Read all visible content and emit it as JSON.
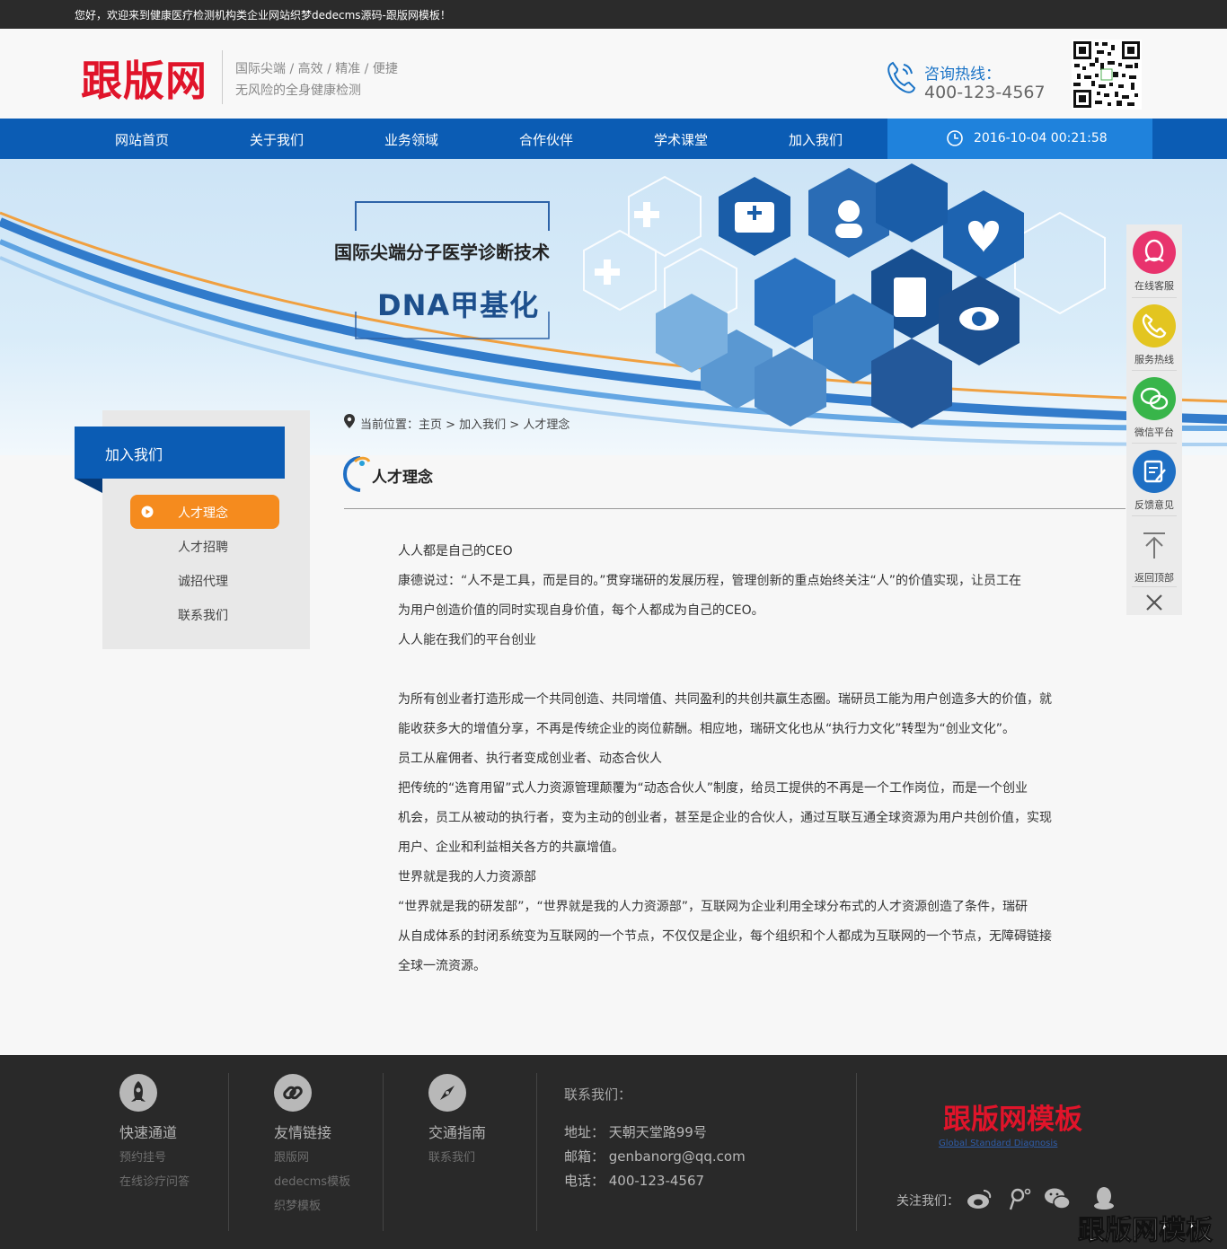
{
  "topbar": {
    "welcome": "您好，欢迎来到健康医疗检测机构类企业网站织梦dedecms源码-跟版网模板！"
  },
  "header": {
    "logo": "跟版网",
    "tagline1": "国际尖端 / 高效 / 精准 / 便捷",
    "tagline2": "无风险的全身健康检测",
    "hotline_label": "咨询热线：",
    "hotline_number": "400-123-4567"
  },
  "nav": {
    "items": [
      {
        "label": "网站首页"
      },
      {
        "label": "关于我们"
      },
      {
        "label": "业务领域"
      },
      {
        "label": "合作伙伴"
      },
      {
        "label": "学术课堂"
      },
      {
        "label": "加入我们"
      }
    ],
    "datetime": "2016-10-04 00:21:58"
  },
  "banner": {
    "title": "国际尖端分子医学诊断技术",
    "subtitle": "DNA甲基化"
  },
  "sidebar": {
    "heading": "加入我们",
    "items": [
      {
        "label": "人才理念"
      },
      {
        "label": "人才招聘"
      },
      {
        "label": "诚招代理"
      },
      {
        "label": "联系我们"
      }
    ]
  },
  "breadcrumb": "当前位置：主页 > 加入我们 > 人才理念",
  "article": {
    "title": "人才理念",
    "lines": [
      " 人人都是自己的CEO",
      "康德说过：“人不是工具，而是目的。”贯穿瑞研的发展历程，管理创新的重点始终关注“人”的价值实现，让员工在",
      "为用户创造价值的同时实现自身价值，每个人都成为自己的CEO。",
      "人人能在我们的平台创业",
      "为所有创业者打造形成一个共同创造、共同增值、共同盈利的共创共赢生态圈。瑞研员工能为用户创造多大的价值，就",
      "能收获多大的增值分享，不再是传统企业的岗位薪酬。相应地，瑞研文化也从“执行力文化”转型为“创业文化”。",
      "员工从雇佣者、执行者变成创业者、动态合伙人",
      "把传统的“选育用留”式人力资源管理颠覆为“动态合伙人”制度，给员工提供的不再是一个工作岗位，而是一个创业",
      "机会，员工从被动的执行者，变为主动的创业者，甚至是企业的合伙人，通过互联互通全球资源为用户共创价值，实现",
      "用户、企业和利益相关各方的共赢增值。",
      "世界就是我的人力资源部",
      "“世界就是我的研发部”，“世界就是我的人力资源部”，互联网为企业利用全球分布式的人才资源创造了条件，瑞研",
      "从自成体系的封闭系统变为互联网的一个节点，不仅仅是企业，每个组织和个人都成为互联网的一个节点，无障碍链接",
      "全球一流资源。"
    ]
  },
  "float_panel": {
    "items": [
      {
        "label": "在线客服",
        "icon": "qq-icon",
        "color": "#e8336d"
      },
      {
        "label": "服务热线",
        "icon": "phone-icon",
        "color": "#e3c520"
      },
      {
        "label": "微信平台",
        "icon": "wechat-icon",
        "color": "#38b54a"
      },
      {
        "label": "反馈意见",
        "icon": "feedback-icon",
        "color": "#1e6fc4"
      },
      {
        "label": "返回顶部",
        "icon": "arrow-up-icon",
        "color": "#ebebeb"
      }
    ]
  },
  "footer": {
    "columns": [
      {
        "title": "快速通道",
        "icon": "rocket-icon",
        "links": [
          "预约挂号",
          "在线诊疗问答"
        ]
      },
      {
        "title": "友情链接",
        "icon": "link-icon",
        "links": [
          "跟版网",
          "dedecms模板",
          "织梦模板"
        ]
      },
      {
        "title": "交通指南",
        "icon": "compass-icon",
        "links": [
          "联系我们"
        ]
      }
    ],
    "contact": {
      "title": "联系我们：",
      "address": "地址： 天朝天堂路99号",
      "email": "邮箱： genbanorg@qq.com",
      "phone": "电话： 400-123-4567"
    },
    "logo": "跟版网模板",
    "logo_sub": "Global Standard Diagnosis",
    "follow": "关注我们：",
    "social_icons": [
      "weibo-icon",
      "tencent-weibo-icon",
      "wechat-icon",
      "qq-icon"
    ],
    "watermark": "跟版网模板"
  },
  "colors": {
    "nav_blue": "#0b5cb4",
    "accent_orange": "#f58b1e",
    "brand_red": "#e0142a"
  }
}
